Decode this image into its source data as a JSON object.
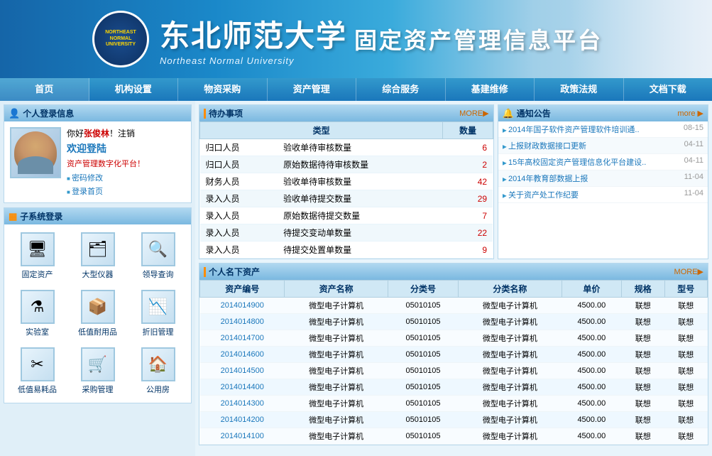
{
  "header": {
    "university_cn": "东北师范大学",
    "university_en": "Northeast Normal University",
    "platform_title": "固定资产管理信息平台",
    "logo_text": "NORTHEAST\nNORMAL\nUNIVERSITY"
  },
  "nav": {
    "items": [
      "首页",
      "机构设置",
      "物资采购",
      "资产管理",
      "综合服务",
      "基建维修",
      "政策法规",
      "文档下载"
    ]
  },
  "sidebar": {
    "personal_section_title": "个人登录信息",
    "welcome_prefix": "你好",
    "username": "张俊林",
    "welcome_suffix": "！注销",
    "welcome_big": "欢迎登陆",
    "platform_link": "资产管理数字化平台！",
    "link1": "密码修改",
    "link2": "登录首页",
    "subsystem_title": "子系统登录",
    "subsystems": [
      {
        "label": "固定资产",
        "icon": "🖥"
      },
      {
        "label": "大型仪器",
        "icon": "🗂"
      },
      {
        "label": "领导查询",
        "icon": "🔍"
      },
      {
        "label": "实验室",
        "icon": "⚙"
      },
      {
        "label": "低值耐用品",
        "icon": "📦"
      },
      {
        "label": "折旧管理",
        "icon": "📊"
      },
      {
        "label": "低值易耗品",
        "icon": "✂"
      },
      {
        "label": "采购管理",
        "icon": "🛒"
      },
      {
        "label": "公用房",
        "icon": "🏠"
      }
    ]
  },
  "todo": {
    "section_title": "待办事项",
    "more_label": "MORE▶",
    "col_type": "类型",
    "col_count": "数量",
    "items": [
      {
        "type": "归口人员",
        "desc": "验收单待审核数量",
        "count": "6"
      },
      {
        "type": "归口人员",
        "desc": "原始数据待待审核数量",
        "count": "2"
      },
      {
        "type": "财务人员",
        "desc": "验收单待审核数量",
        "count": "42"
      },
      {
        "type": "录入人员",
        "desc": "验收单待提交数量",
        "count": "29"
      },
      {
        "type": "录入人员",
        "desc": "原始数据待提交数量",
        "count": "7"
      },
      {
        "type": "录入人员",
        "desc": "待提交变动单数量",
        "count": "22"
      },
      {
        "type": "录入人员",
        "desc": "待提交处置单数量",
        "count": "9"
      }
    ]
  },
  "notice": {
    "section_title": "通知公告",
    "more_label": "more ▶",
    "items": [
      {
        "text": "2014年国子软件资产管理软件培训通..",
        "date": "08-15"
      },
      {
        "text": "上报财政数据接口更新",
        "date": "04-11"
      },
      {
        "text": "15年高校固定资产管理信息化平台建设..",
        "date": "04-11"
      },
      {
        "text": "2014年教育部数据上报",
        "date": "11-04"
      },
      {
        "text": "关于资产处工作纪要",
        "date": "11-04"
      }
    ]
  },
  "assets": {
    "section_title": "个人名下资产",
    "more_label": "MORE▶",
    "cols": [
      "资产编号",
      "资产名称",
      "分类号",
      "分类名称",
      "单价",
      "规格",
      "型号"
    ],
    "rows": [
      {
        "id": "2014014900",
        "name": "微型电子计算机",
        "code": "05010105",
        "category": "微型电子计算机",
        "price": "4500.00",
        "spec": "联想",
        "model": "联想"
      },
      {
        "id": "2014014800",
        "name": "微型电子计算机",
        "code": "05010105",
        "category": "微型电子计算机",
        "price": "4500.00",
        "spec": "联想",
        "model": "联想"
      },
      {
        "id": "2014014700",
        "name": "微型电子计算机",
        "code": "05010105",
        "category": "微型电子计算机",
        "price": "4500.00",
        "spec": "联想",
        "model": "联想"
      },
      {
        "id": "2014014600",
        "name": "微型电子计算机",
        "code": "05010105",
        "category": "微型电子计算机",
        "price": "4500.00",
        "spec": "联想",
        "model": "联想"
      },
      {
        "id": "2014014500",
        "name": "微型电子计算机",
        "code": "05010105",
        "category": "微型电子计算机",
        "price": "4500.00",
        "spec": "联想",
        "model": "联想"
      },
      {
        "id": "2014014400",
        "name": "微型电子计算机",
        "code": "05010105",
        "category": "微型电子计算机",
        "price": "4500.00",
        "spec": "联想",
        "model": "联想"
      },
      {
        "id": "2014014300",
        "name": "微型电子计算机",
        "code": "05010105",
        "category": "微型电子计算机",
        "price": "4500.00",
        "spec": "联想",
        "model": "联想"
      },
      {
        "id": "2014014200",
        "name": "微型电子计算机",
        "code": "05010105",
        "category": "微型电子计算机",
        "price": "4500.00",
        "spec": "联想",
        "model": "联想"
      },
      {
        "id": "2014014100",
        "name": "微型电子计算机",
        "code": "05010105",
        "category": "微型电子计算机",
        "price": "4500.00",
        "spec": "联想",
        "model": "联想"
      }
    ]
  }
}
